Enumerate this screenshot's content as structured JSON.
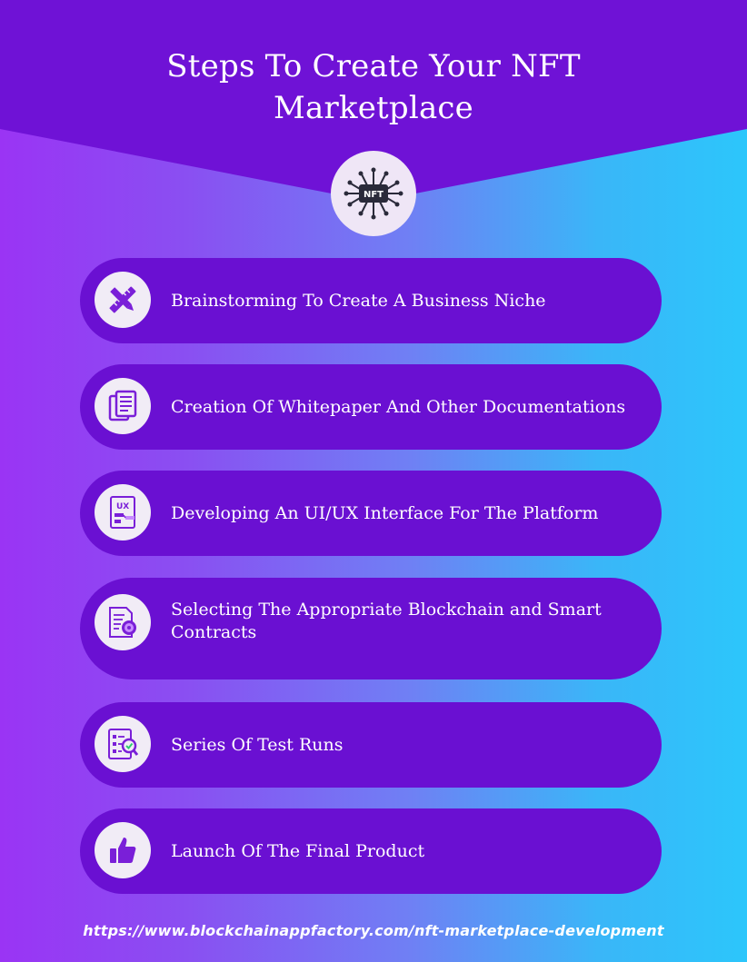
{
  "header": {
    "title_line1": "Steps To Create Your NFT",
    "title_line2": "Marketplace",
    "badge_icon": "nft-circuit-icon",
    "badge_text": "NFT"
  },
  "steps": [
    {
      "label": "Brainstorming To Create A Business Niche",
      "icon": "pencil-ruler-icon"
    },
    {
      "label": "Creation Of Whitepaper And Other Documentations",
      "icon": "documents-icon"
    },
    {
      "label": "Developing An UI/UX Interface For The Platform",
      "icon": "ux-design-icon"
    },
    {
      "label": "Selecting The Appropriate Blockchain and Smart Contracts",
      "icon": "contract-target-icon"
    },
    {
      "label": "Series Of Test Runs",
      "icon": "test-checklist-icon"
    },
    {
      "label": "Launch Of The Final Product",
      "icon": "thumbs-up-icon"
    }
  ],
  "footer": {
    "url": "https://www.blockchainappfactory.com/nft-marketplace-development"
  },
  "colors": {
    "header_bg": "#6f12d6",
    "pill_bg": "#6a10d2",
    "icon_bg": "#f1ecf6",
    "icon_fg": "#7a1fd8",
    "gradient_left": "#9a34f4",
    "gradient_right": "#2cc6fb"
  }
}
